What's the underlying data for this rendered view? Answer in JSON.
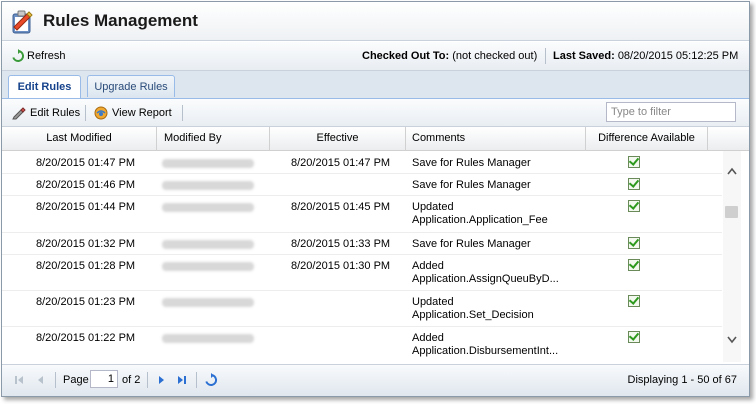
{
  "window": {
    "title": "Rules Management"
  },
  "toolbar": {
    "refresh_label": "Refresh",
    "checked_out_label": "Checked Out To:",
    "checked_out_value": "(not checked out)",
    "last_saved_label": "Last Saved:",
    "last_saved_value": "08/20/2015 05:12:25 PM"
  },
  "tabs": [
    {
      "label": "Edit Rules",
      "active": true
    },
    {
      "label": "Upgrade Rules",
      "active": false
    }
  ],
  "subtoolbar": {
    "edit_rules_label": "Edit Rules",
    "view_report_label": "View Report",
    "filter_placeholder": "Type to filter"
  },
  "columns": [
    "Last Modified",
    "Modified By",
    "Effective",
    "Comments",
    "Difference Available"
  ],
  "rows": [
    {
      "last_modified": "8/20/2015 01:47 PM",
      "effective": "8/20/2015 01:47 PM",
      "comment1": "Save for Rules Manager",
      "comment2": "",
      "diff": true
    },
    {
      "last_modified": "8/20/2015 01:46 PM",
      "effective": "",
      "comment1": "Save for Rules Manager",
      "comment2": "",
      "diff": true
    },
    {
      "last_modified": "8/20/2015 01:44 PM",
      "effective": "8/20/2015 01:45 PM",
      "comment1": "Updated",
      "comment2": "Application.Application_Fee",
      "diff": true
    },
    {
      "last_modified": "8/20/2015 01:32 PM",
      "effective": "8/20/2015 01:33 PM",
      "comment1": "Save for Rules Manager",
      "comment2": "",
      "diff": true
    },
    {
      "last_modified": "8/20/2015 01:28 PM",
      "effective": "8/20/2015 01:30 PM",
      "comment1": "Added",
      "comment2": "Application.AssignQueuByD...",
      "diff": true
    },
    {
      "last_modified": "8/20/2015 01:23 PM",
      "effective": "",
      "comment1": "Updated",
      "comment2": "Application.Set_Decision",
      "diff": true
    },
    {
      "last_modified": "8/20/2015 01:22 PM",
      "effective": "",
      "comment1": "Added",
      "comment2": "Application.DisbursementInt...",
      "diff": true
    }
  ],
  "pager": {
    "page_label": "Page",
    "page_value": "1",
    "of_label": "of 2",
    "display_text": "Displaying 1 - 50 of 67"
  },
  "colors": {
    "tab_active_text": "#15428b",
    "header_border": "#99bbe8",
    "check_green": "#2e9a1e",
    "pager_blue": "#2a6fd1"
  }
}
